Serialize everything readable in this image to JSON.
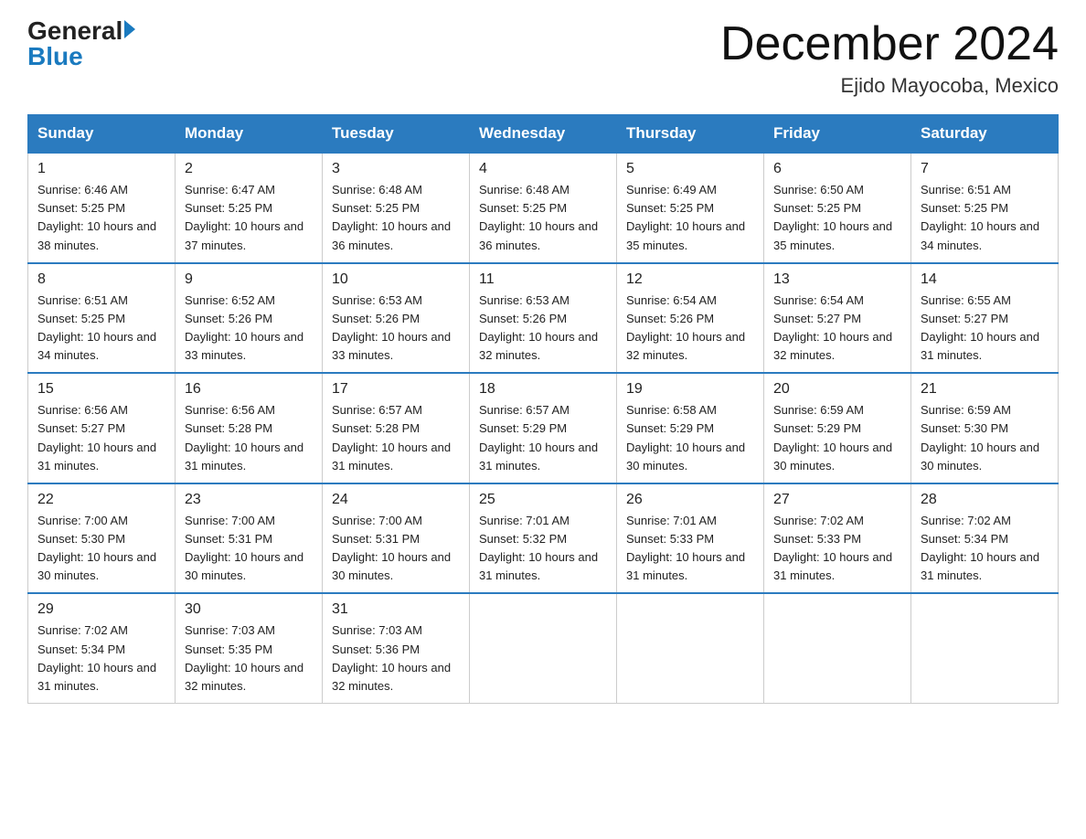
{
  "logo": {
    "text_general": "General",
    "text_blue": "Blue",
    "arrow": "▶"
  },
  "calendar": {
    "title": "December 2024",
    "subtitle": "Ejido Mayocoba, Mexico"
  },
  "headers": [
    "Sunday",
    "Monday",
    "Tuesday",
    "Wednesday",
    "Thursday",
    "Friday",
    "Saturday"
  ],
  "weeks": [
    [
      {
        "day": "1",
        "sunrise": "6:46 AM",
        "sunset": "5:25 PM",
        "daylight": "10 hours and 38 minutes."
      },
      {
        "day": "2",
        "sunrise": "6:47 AM",
        "sunset": "5:25 PM",
        "daylight": "10 hours and 37 minutes."
      },
      {
        "day": "3",
        "sunrise": "6:48 AM",
        "sunset": "5:25 PM",
        "daylight": "10 hours and 36 minutes."
      },
      {
        "day": "4",
        "sunrise": "6:48 AM",
        "sunset": "5:25 PM",
        "daylight": "10 hours and 36 minutes."
      },
      {
        "day": "5",
        "sunrise": "6:49 AM",
        "sunset": "5:25 PM",
        "daylight": "10 hours and 35 minutes."
      },
      {
        "day": "6",
        "sunrise": "6:50 AM",
        "sunset": "5:25 PM",
        "daylight": "10 hours and 35 minutes."
      },
      {
        "day": "7",
        "sunrise": "6:51 AM",
        "sunset": "5:25 PM",
        "daylight": "10 hours and 34 minutes."
      }
    ],
    [
      {
        "day": "8",
        "sunrise": "6:51 AM",
        "sunset": "5:25 PM",
        "daylight": "10 hours and 34 minutes."
      },
      {
        "day": "9",
        "sunrise": "6:52 AM",
        "sunset": "5:26 PM",
        "daylight": "10 hours and 33 minutes."
      },
      {
        "day": "10",
        "sunrise": "6:53 AM",
        "sunset": "5:26 PM",
        "daylight": "10 hours and 33 minutes."
      },
      {
        "day": "11",
        "sunrise": "6:53 AM",
        "sunset": "5:26 PM",
        "daylight": "10 hours and 32 minutes."
      },
      {
        "day": "12",
        "sunrise": "6:54 AM",
        "sunset": "5:26 PM",
        "daylight": "10 hours and 32 minutes."
      },
      {
        "day": "13",
        "sunrise": "6:54 AM",
        "sunset": "5:27 PM",
        "daylight": "10 hours and 32 minutes."
      },
      {
        "day": "14",
        "sunrise": "6:55 AM",
        "sunset": "5:27 PM",
        "daylight": "10 hours and 31 minutes."
      }
    ],
    [
      {
        "day": "15",
        "sunrise": "6:56 AM",
        "sunset": "5:27 PM",
        "daylight": "10 hours and 31 minutes."
      },
      {
        "day": "16",
        "sunrise": "6:56 AM",
        "sunset": "5:28 PM",
        "daylight": "10 hours and 31 minutes."
      },
      {
        "day": "17",
        "sunrise": "6:57 AM",
        "sunset": "5:28 PM",
        "daylight": "10 hours and 31 minutes."
      },
      {
        "day": "18",
        "sunrise": "6:57 AM",
        "sunset": "5:29 PM",
        "daylight": "10 hours and 31 minutes."
      },
      {
        "day": "19",
        "sunrise": "6:58 AM",
        "sunset": "5:29 PM",
        "daylight": "10 hours and 30 minutes."
      },
      {
        "day": "20",
        "sunrise": "6:59 AM",
        "sunset": "5:29 PM",
        "daylight": "10 hours and 30 minutes."
      },
      {
        "day": "21",
        "sunrise": "6:59 AM",
        "sunset": "5:30 PM",
        "daylight": "10 hours and 30 minutes."
      }
    ],
    [
      {
        "day": "22",
        "sunrise": "7:00 AM",
        "sunset": "5:30 PM",
        "daylight": "10 hours and 30 minutes."
      },
      {
        "day": "23",
        "sunrise": "7:00 AM",
        "sunset": "5:31 PM",
        "daylight": "10 hours and 30 minutes."
      },
      {
        "day": "24",
        "sunrise": "7:00 AM",
        "sunset": "5:31 PM",
        "daylight": "10 hours and 30 minutes."
      },
      {
        "day": "25",
        "sunrise": "7:01 AM",
        "sunset": "5:32 PM",
        "daylight": "10 hours and 31 minutes."
      },
      {
        "day": "26",
        "sunrise": "7:01 AM",
        "sunset": "5:33 PM",
        "daylight": "10 hours and 31 minutes."
      },
      {
        "day": "27",
        "sunrise": "7:02 AM",
        "sunset": "5:33 PM",
        "daylight": "10 hours and 31 minutes."
      },
      {
        "day": "28",
        "sunrise": "7:02 AM",
        "sunset": "5:34 PM",
        "daylight": "10 hours and 31 minutes."
      }
    ],
    [
      {
        "day": "29",
        "sunrise": "7:02 AM",
        "sunset": "5:34 PM",
        "daylight": "10 hours and 31 minutes."
      },
      {
        "day": "30",
        "sunrise": "7:03 AM",
        "sunset": "5:35 PM",
        "daylight": "10 hours and 32 minutes."
      },
      {
        "day": "31",
        "sunrise": "7:03 AM",
        "sunset": "5:36 PM",
        "daylight": "10 hours and 32 minutes."
      },
      null,
      null,
      null,
      null
    ]
  ]
}
